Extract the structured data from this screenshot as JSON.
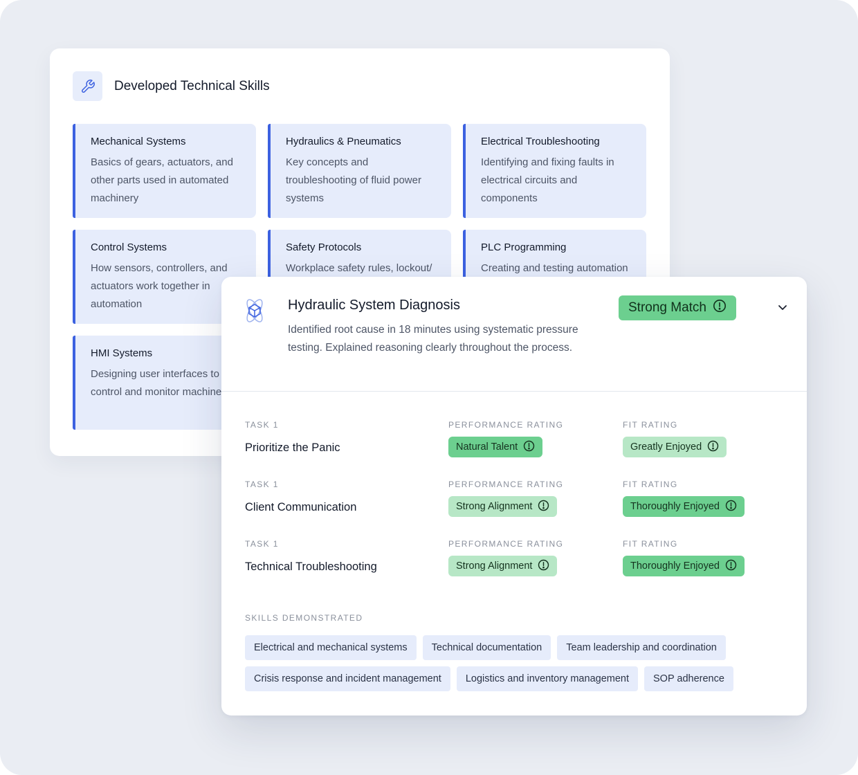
{
  "skills_panel": {
    "icon": "wrench-icon",
    "title": "Developed Technical Skills",
    "tiles": [
      {
        "title": "Mechanical Systems",
        "desc": "Basics of gears, actuators, and other parts used in automated machinery"
      },
      {
        "title": "Hydraulics & Pneumatics",
        "desc": "Key concepts and troubleshooting of fluid power systems"
      },
      {
        "title": "Electrical Troubleshooting",
        "desc": "Identifying and fixing faults in electrical circuits and components"
      },
      {
        "title": "Control Systems",
        "desc": "How sensors, controllers, and actuators work together in automation"
      },
      {
        "title": "Safety Protocols",
        "desc": "Workplace safety rules, lockout/"
      },
      {
        "title": "PLC Programming",
        "desc": "Creating and testing automation"
      },
      {
        "title": "HMI Systems",
        "desc": "Designing user interfaces to control and monitor machines"
      }
    ]
  },
  "diagnosis": {
    "icon": "cube-atom-icon",
    "title": "Hydraulic System Diagnosis",
    "description": "Identified root cause in 18 minutes using systematic pressure testing. Explained reasoning clearly throughout the process.",
    "match_label": "Strong Match",
    "labels": {
      "task": "TASK 1",
      "performance": "PERFORMANCE RATING",
      "fit": "FIT RATING",
      "skills": "SKILLS DEMONSTRATED"
    },
    "tasks": [
      {
        "name": "Prioritize the Panic",
        "performance": "Natural Talent",
        "fit": "Greatly Enjoyed"
      },
      {
        "name": "Client Communication",
        "performance": "Strong Alignment",
        "fit": "Thoroughly Enjoyed"
      },
      {
        "name": "Technical Troubleshooting",
        "performance": "Strong Alignment",
        "fit": "Thoroughly Enjoyed"
      }
    ],
    "skills": [
      "Electrical and mechanical systems",
      "Technical documentation",
      "Team leadership and coordination",
      "Crisis response and incident management",
      "Logistics and inventory management",
      "SOP adherence"
    ]
  },
  "colors": {
    "accent_blue": "#3c61e0",
    "tile_bg": "#e6ecfb",
    "match_green": "#6ccf8f",
    "light_green": "#b7e7c6",
    "page_bg": "#eaedf3"
  }
}
